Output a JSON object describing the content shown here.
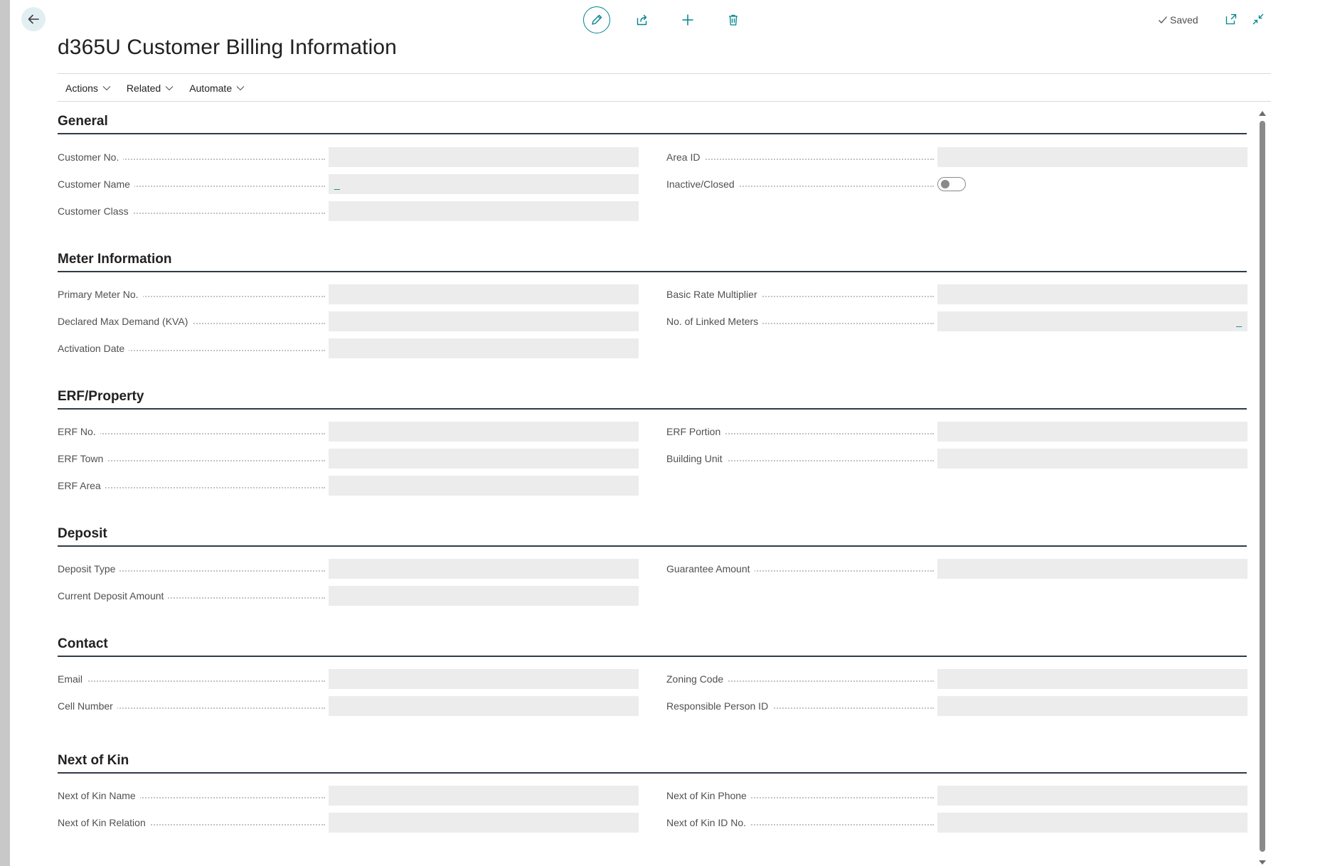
{
  "header": {
    "title": "d365U Customer Billing Information",
    "saved_label": "Saved"
  },
  "menu": [
    {
      "label": "Actions"
    },
    {
      "label": "Related"
    },
    {
      "label": "Automate"
    }
  ],
  "toolbar_icons": [
    "back-arrow-icon",
    "edit-pencil-icon",
    "share-icon",
    "plus-icon",
    "delete-bin-icon",
    "checkmark-icon",
    "open-new-window-icon",
    "collapse-icon"
  ],
  "accent_color": "#00838f",
  "sections": {
    "general": {
      "title": "General",
      "customer_no": {
        "label": "Customer No.",
        "value": ""
      },
      "customer_name": {
        "label": "Customer Name",
        "value": "_"
      },
      "customer_class": {
        "label": "Customer Class",
        "value": ""
      },
      "area_id": {
        "label": "Area ID",
        "value": ""
      },
      "inactive_closed": {
        "label": "Inactive/Closed",
        "value": false
      }
    },
    "meter": {
      "title": "Meter Information",
      "primary_meter_no": {
        "label": "Primary Meter No.",
        "value": ""
      },
      "declared_max_demand": {
        "label": "Declared Max Demand (KVA)",
        "value": ""
      },
      "activation_date": {
        "label": "Activation Date",
        "value": ""
      },
      "basic_rate_multiplier": {
        "label": "Basic Rate Multiplier",
        "value": ""
      },
      "linked_meters": {
        "label": "No. of Linked Meters",
        "value": "_"
      }
    },
    "erf": {
      "title": "ERF/Property",
      "erf_no": {
        "label": "ERF No.",
        "value": ""
      },
      "erf_town": {
        "label": "ERF Town",
        "value": ""
      },
      "erf_area": {
        "label": "ERF Area",
        "value": ""
      },
      "erf_portion": {
        "label": "ERF Portion",
        "value": ""
      },
      "building_unit": {
        "label": "Building Unit",
        "value": ""
      }
    },
    "deposit": {
      "title": "Deposit",
      "deposit_type": {
        "label": "Deposit Type",
        "value": ""
      },
      "current_deposit_amount": {
        "label": "Current Deposit Amount",
        "value": ""
      },
      "guarantee_amount": {
        "label": "Guarantee Amount",
        "value": ""
      }
    },
    "contact": {
      "title": "Contact",
      "email": {
        "label": "Email",
        "value": ""
      },
      "cell_number": {
        "label": "Cell Number",
        "value": ""
      },
      "zoning_code": {
        "label": "Zoning Code",
        "value": ""
      },
      "responsible_person_id": {
        "label": "Responsible Person ID",
        "value": ""
      }
    },
    "next_of_kin": {
      "title": "Next of Kin",
      "name": {
        "label": "Next of Kin Name",
        "value": ""
      },
      "relation": {
        "label": "Next of Kin Relation",
        "value": ""
      },
      "phone": {
        "label": "Next of Kin Phone",
        "value": ""
      },
      "id_no": {
        "label": "Next of Kin ID No.",
        "value": ""
      }
    }
  }
}
